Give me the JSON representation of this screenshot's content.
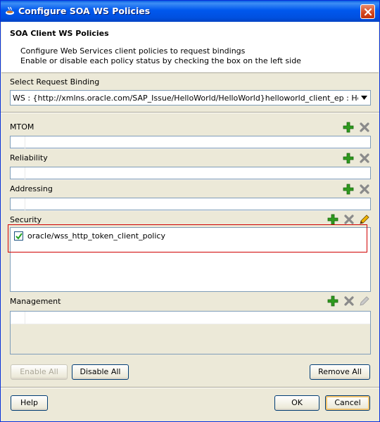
{
  "window": {
    "title": "Configure SOA WS Policies",
    "icon": "oracle-cup-icon"
  },
  "header": {
    "title": "SOA Client WS Policies",
    "desc_line1": "Configure Web Services client policies to request bindings",
    "desc_line2": "Enable or disable each policy status by checking the box on the left side"
  },
  "binding": {
    "label": "Select Request Binding",
    "value": "WS : {http://xmlns.oracle.com/SAP_Issue/HelloWorld/HelloWorld}helloworld_client_ep : HelloWorld_pt"
  },
  "sections": {
    "mtom": {
      "label": "MTOM"
    },
    "reliability": {
      "label": "Reliability"
    },
    "addressing": {
      "label": "Addressing"
    },
    "security": {
      "label": "Security",
      "policies": [
        {
          "name": "oracle/wss_http_token_client_policy",
          "enabled": true
        }
      ]
    },
    "management": {
      "label": "Management"
    }
  },
  "actions": {
    "enable_all": "Enable All",
    "disable_all": "Disable All",
    "remove_all": "Remove All"
  },
  "footer": {
    "help": "Help",
    "ok": "OK",
    "cancel": "Cancel"
  },
  "colors": {
    "add": "#2e9b1e",
    "remove": "#8a8a8a",
    "highlight": "#d00000",
    "title_bar": "#0058ee"
  }
}
